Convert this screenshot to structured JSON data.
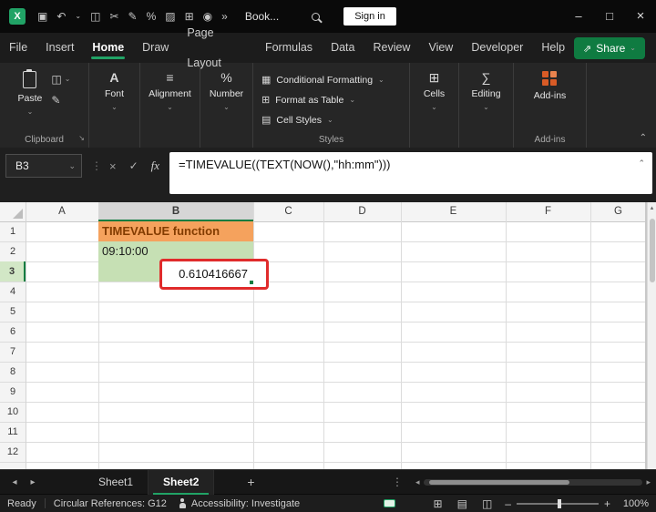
{
  "titlebar": {
    "workbook_name": "Book...",
    "signin_label": "Sign in",
    "excel_logo_letter": "X",
    "quick_icons": [
      {
        "name": "save-icon",
        "glyph": "▣"
      },
      {
        "name": "undo-icon",
        "glyph": "↶"
      },
      {
        "name": "undo-menu-icon",
        "glyph": "⌄"
      },
      {
        "name": "copy-icon",
        "glyph": "◫"
      },
      {
        "name": "cut-icon",
        "glyph": "✂"
      },
      {
        "name": "format-painter-icon",
        "glyph": "✎"
      },
      {
        "name": "percent-style-icon",
        "glyph": "%"
      },
      {
        "name": "fill-color-icon",
        "glyph": "▨"
      },
      {
        "name": "borders-icon",
        "glyph": "⊞"
      },
      {
        "name": "camera-icon",
        "glyph": "◉"
      },
      {
        "name": "more-commands-icon",
        "glyph": "»"
      }
    ]
  },
  "menu": {
    "items": [
      "File",
      "Insert",
      "Home",
      "Draw",
      "Page Layout",
      "Formulas",
      "Data",
      "Review",
      "View",
      "Developer",
      "Help"
    ],
    "active_item": "Home",
    "share_label": "Share"
  },
  "ribbon": {
    "paste_label": "Paste",
    "font_label": "Font",
    "alignment_label": "Alignment",
    "number_label": "Number",
    "cells_label": "Cells",
    "editing_label": "Editing",
    "conditional_formatting_label": "Conditional Formatting",
    "format_as_table_label": "Format as Table",
    "cell_styles_label": "Cell Styles",
    "addins_button_label": "Add-ins",
    "clipboard_group_label": "Clipboard",
    "styles_group_label": "Styles",
    "addins_group_label": "Add-ins"
  },
  "formula_bar": {
    "name_box_value": "B3",
    "fx_label": "fx",
    "formula": "=TIMEVALUE((TEXT(NOW(),\"hh:mm\")))"
  },
  "grid": {
    "columns": [
      "A",
      "B",
      "C",
      "D",
      "E",
      "F",
      "G"
    ],
    "rows": [
      "1",
      "2",
      "3",
      "4",
      "5",
      "6",
      "7",
      "8",
      "9",
      "10",
      "11",
      "12"
    ],
    "selected_cell": "B3",
    "cells": {
      "b1": "TIMEVALUE function",
      "b2": "09:10:00",
      "b3": "0.610416667"
    }
  },
  "sheet_tabs": {
    "tabs": [
      "Sheet1",
      "Sheet2"
    ],
    "active_tab": "Sheet2",
    "add_sheet_label": "+"
  },
  "status_bar": {
    "mode": "Ready",
    "circular_references": "Circular References: G12",
    "accessibility": "Accessibility: Investigate",
    "zoom_level": "100%"
  },
  "colors": {
    "excel_green": "#107C41",
    "accent_green": "#21A366",
    "orange_cell_fill": "#F5A25D",
    "orange_cell_text": "#833C00",
    "green_cell_fill": "#C6E0B4",
    "annotation_red": "#E02B2B",
    "addins_icon_orange": "#D85B26"
  }
}
